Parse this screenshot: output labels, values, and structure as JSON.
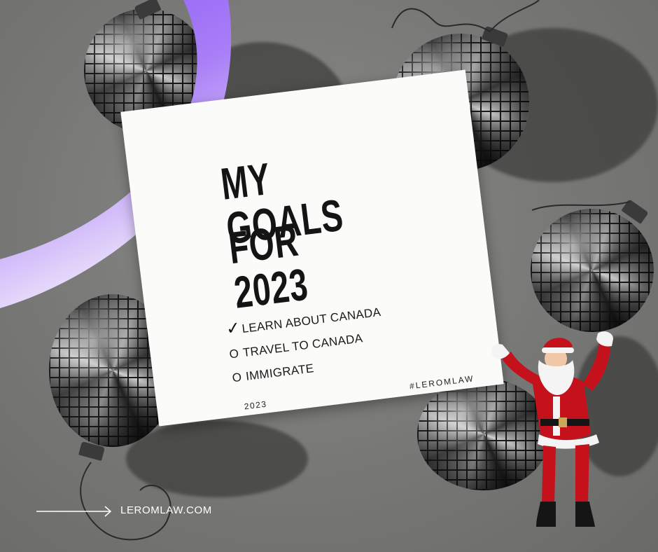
{
  "card": {
    "title_line1": "MY GOALS",
    "title_line2": "FOR 2023",
    "goals": [
      {
        "mark": "✓",
        "text": "LEARN ABOUT CANADA"
      },
      {
        "mark": "O",
        "text": "TRAVEL TO CANADA"
      },
      {
        "mark": "O",
        "text": "IMMIGRATE"
      }
    ],
    "year": "2023",
    "hashtag": "#LEROMLAW"
  },
  "footer": {
    "website": "LEROMLAW.COM",
    "arrow_icon": "arrow-right-icon"
  },
  "colors": {
    "background": "#7a7a78",
    "card": "#fbfbf9",
    "ribbon_top": "#8c5cf5",
    "ribbon_bottom": "#efe8fb",
    "santa_red": "#c4111c"
  },
  "icons": [
    "disco-ball-icon",
    "santa-figure",
    "ribbon-swoosh",
    "checkmark-icon"
  ]
}
